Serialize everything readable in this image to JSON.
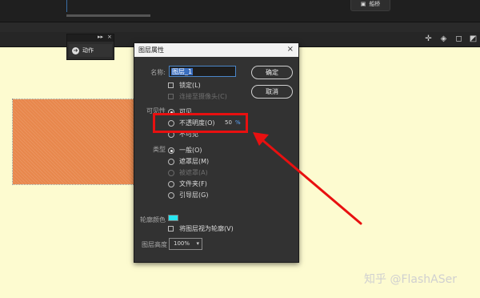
{
  "top": {
    "composition_button": "船桥"
  },
  "actions_panel": {
    "tab_label": "动作",
    "expand_glyph": "▸▸",
    "close_glyph": "×"
  },
  "dialog": {
    "title": "图层属性",
    "close_glyph": "×",
    "name_label": "名称:",
    "name_value": "图层_1",
    "lock_label": "锁定(L)",
    "link_camera_label": "连接至摄像头(C)",
    "visibility_label": "可见性",
    "visibility_options": {
      "visible": "可见",
      "opacity": "不透明度(O)",
      "invisible": "不可见"
    },
    "opacity_value": "50",
    "opacity_unit": "%",
    "type_label": "类型",
    "type_options": {
      "normal": "一般(O)",
      "mask": "遮罩层(M)",
      "masked": "被遮罩(A)",
      "folder": "文件夹(F)",
      "guide": "引导层(G)"
    },
    "outline_color_label": "轮廓颜色",
    "outline_color": "#28e6f0",
    "outline_view_label": "将图层视为轮廓(V)",
    "height_label": "图层高度",
    "height_value": "100%",
    "ok_button": "确定",
    "cancel_button": "取消"
  },
  "annotation": {
    "highlight_color": "#e81010"
  },
  "watermark": "知乎 @FlashASer"
}
